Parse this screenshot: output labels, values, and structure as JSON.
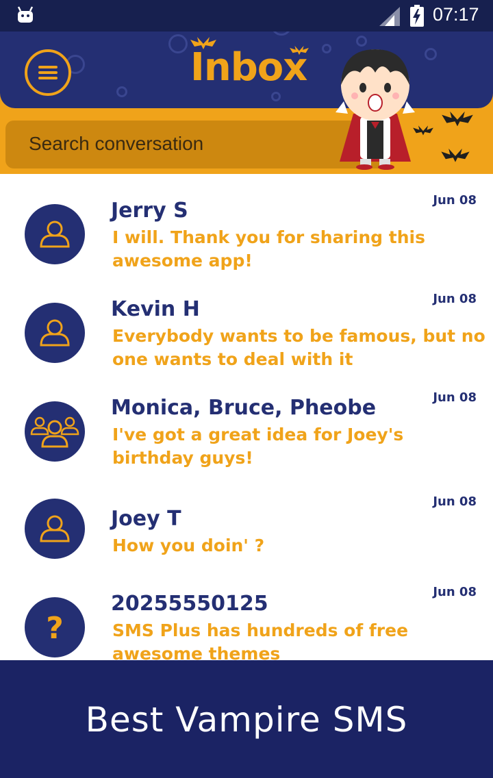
{
  "status_bar": {
    "time": "07:17",
    "icons": [
      "android-icon",
      "signal-icon",
      "battery-charging-icon"
    ]
  },
  "header": {
    "title": "Inbox",
    "menu_icon": "hamburger-menu-icon",
    "search_placeholder": "Search conversation",
    "colors": {
      "navy": "#242f73",
      "orange": "#f0a31a"
    }
  },
  "conversations": [
    {
      "name": "Jerry S",
      "snippet": "I will. Thank you for sharing this awesome app!",
      "date": "Jun 08",
      "avatar": "person-icon"
    },
    {
      "name": "Kevin H",
      "snippet": "Everybody wants to be famous, but no one wants to deal with it",
      "date": "Jun 08",
      "avatar": "person-icon"
    },
    {
      "name": "Monica, Bruce, Pheobe",
      "snippet": "I've got a great idea for Joey's birthday guys!",
      "date": "Jun 08",
      "avatar": "group-icon"
    },
    {
      "name": "Joey T",
      "snippet": "How you doin' ?",
      "date": "Jun 08",
      "avatar": "person-icon"
    },
    {
      "name": "20255550125",
      "snippet": "SMS Plus has hundreds of free awesome themes",
      "date": "Jun 08",
      "avatar": "question-mark-icon"
    }
  ],
  "banner": {
    "text": "Best Vampire SMS"
  }
}
